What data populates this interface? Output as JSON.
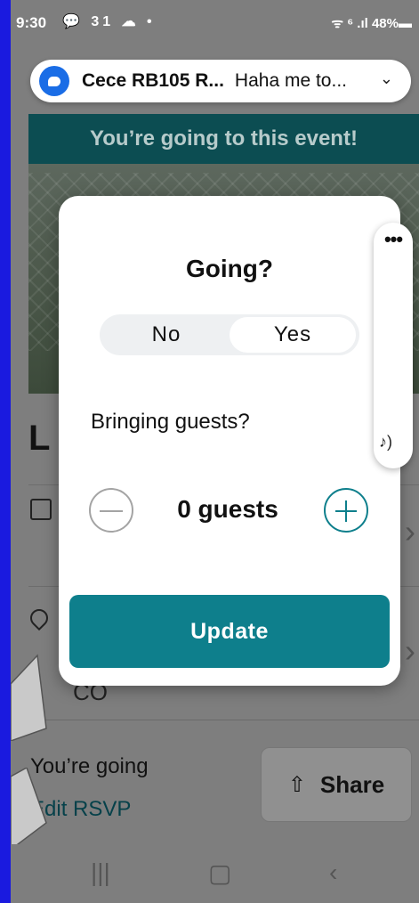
{
  "status_bar": {
    "time": "9:30",
    "left_icons": "💬 31 ☁ •",
    "right_icons": "ᯤ ⁶ .ıl 48%▬"
  },
  "notification": {
    "sender": "Cece RB105 R...",
    "message": "Haha me to..."
  },
  "background": {
    "banner": "You’re going to this event!",
    "heading": "L",
    "location_suffix": "CO"
  },
  "modal": {
    "title": "Going?",
    "options": [
      "No",
      "Yes"
    ],
    "selected_option": "Yes",
    "guests_label": "Bringing guests?",
    "guest_count_text": "0 guests",
    "update_label": "Update"
  },
  "bottom_bar": {
    "status": "You’re going",
    "edit_link": "Edit RSVP",
    "share_label": "Share"
  },
  "side_panel": {
    "menu": "•••"
  },
  "colors": {
    "accent": "#0e7f8c",
    "banner": "#0c4d52",
    "overlay_bg": "#7e7e7e",
    "frame": "#1a1adf"
  }
}
